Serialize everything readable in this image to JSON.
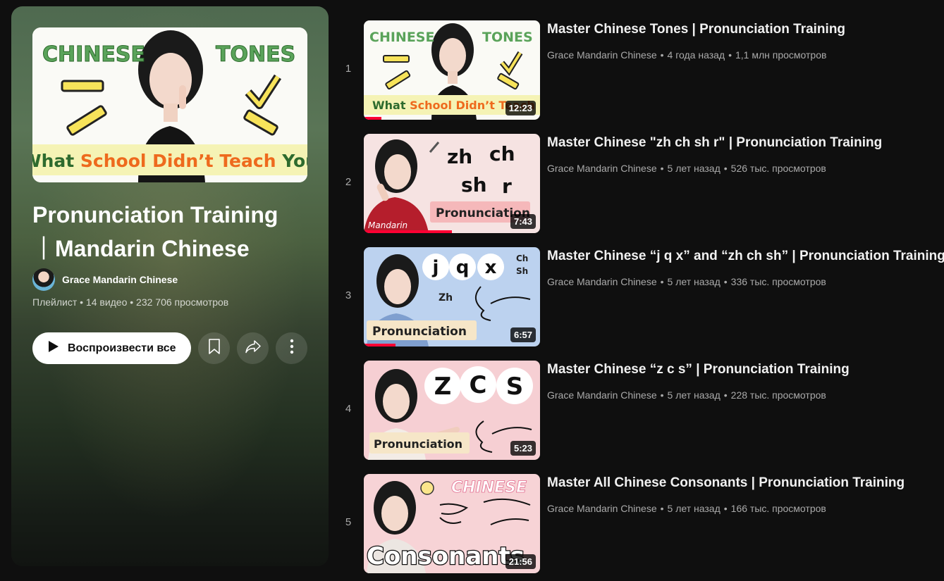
{
  "playlist": {
    "title_line1": "Pronunciation Training",
    "title_line2": "｜Mandarin Chinese",
    "owner": "Grace Mandarin Chinese",
    "stats": "Плейлист • 14 видео • 232 706 просмотров",
    "play_label": "Воспроизвести все",
    "cover": {
      "left_word": "CHINESE",
      "right_word": "TONES",
      "banner": [
        "What ",
        "School Didn’t Teach",
        " You"
      ]
    },
    "icons": [
      "play-icon",
      "bookmark-icon",
      "share-icon",
      "more-icon"
    ]
  },
  "videos": [
    {
      "index": "1",
      "title": "Master Chinese Tones | Pronunciation Training",
      "channel": "Grace Mandarin Chinese",
      "age": "4 года назад",
      "views": "1,1 млн просмотров",
      "duration": "12:23",
      "watched": 0.1,
      "thumb": {
        "left": "CHINESE",
        "right": "TONES",
        "banner_a": "What ",
        "banner_b": "School Didn’t Teach",
        "bg": "#fafaf5"
      }
    },
    {
      "index": "2",
      "title": "Master Chinese \"zh ch sh r\" | Pronunciation Training",
      "channel": "Grace Mandarin Chinese",
      "age": "5 лет назад",
      "views": "526 тыс. просмотров",
      "duration": "7:43",
      "watched": 0.5,
      "thumb": {
        "l1a": "zh",
        "l1b": "ch",
        "l2a": "sh",
        "l2b": "r",
        "label": "Pronunciation",
        "corner": "Mandarin",
        "bg": "#f6e3e2"
      }
    },
    {
      "index": "3",
      "title": "Master Chinese “j q x” and “zh ch sh” | Pronunciation Training",
      "channel": "Grace Mandarin Chinese",
      "age": "5 лет назад",
      "views": "336 тыс. просмотров",
      "duration": "6:57",
      "watched": 0.18,
      "thumb": {
        "c1": "j",
        "c2": "q",
        "c3": "x",
        "s1": "Ch",
        "s2": "Sh",
        "s3": "Zh",
        "label": "Pronunciation",
        "bg": "#bcd2ef"
      }
    },
    {
      "index": "4",
      "title": "Master Chinese “z c s” | Pronunciation Training",
      "channel": "Grace Mandarin Chinese",
      "age": "5 лет назад",
      "views": "228 тыс. просмотров",
      "duration": "5:23",
      "watched": 0,
      "thumb": {
        "c1": "Z",
        "c2": "C",
        "c3": "S",
        "label": "Pronunciation",
        "bg": "#f6cfd3"
      }
    },
    {
      "index": "5",
      "title": "Master All Chinese Consonants | Pronunciation Training",
      "channel": "Grace Mandarin Chinese",
      "age": "5 лет назад",
      "views": "166 тыс. просмотров",
      "duration": "21:56",
      "watched": 0,
      "thumb": {
        "top": "CHINESE",
        "bottom": "Consonants",
        "bg": "#f7d3d6"
      }
    }
  ]
}
